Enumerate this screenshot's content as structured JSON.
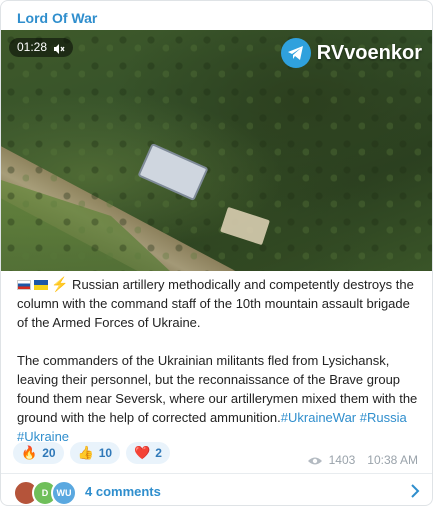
{
  "channel": {
    "name": "Lord Of War"
  },
  "video": {
    "duration": "01:28",
    "brand": "RVvoenkor",
    "muted_icon": "volume-muted-icon"
  },
  "post": {
    "paragraph1": " Russian artillery methodically and competently destroys the column with the command staff of the 10th mountain assault brigade of the Armed Forces of Ukraine.",
    "paragraph2": " The commanders of the Ukrainian militants fled from Lysichansk, leaving their personnel, but the reconnaissance of the Brave group found them near Seversk, where our artillerymen mixed them with the ground with the help of corrected ammunition.",
    "hashtags": [
      "#UkraineWar",
      "#Russia",
      "#Ukraine"
    ]
  },
  "reactions": [
    {
      "emoji": "🔥",
      "count": "20"
    },
    {
      "emoji": "👍",
      "count": "10"
    },
    {
      "emoji": "❤️",
      "count": "2"
    }
  ],
  "meta": {
    "views": "1403",
    "time": "10:38 AM"
  },
  "comments": {
    "label": "4 comments",
    "avatars": [
      {
        "initials": "",
        "color": "#b5543a"
      },
      {
        "initials": "D",
        "color": "#6fbf5a"
      },
      {
        "initials": "WU",
        "color": "#5aa8e0"
      }
    ]
  },
  "colors": {
    "accent": "#2f8ecd",
    "reaction_bg": "#e9f3fb"
  }
}
